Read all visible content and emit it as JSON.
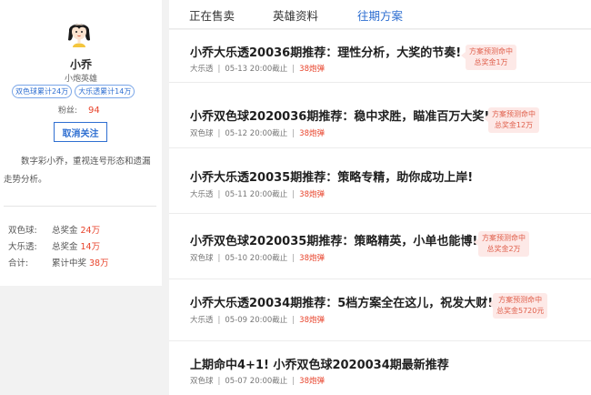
{
  "profile": {
    "name": "小乔",
    "subtitle": "小炮英雄",
    "tags": [
      "双色球累计24万",
      "大乐透累计14万"
    ],
    "fans_label": "粉丝:",
    "fans_value": "94",
    "unfollow_label": "取消关注",
    "bio": "数字彩小乔，重视连号形态和遗漏走势分析。",
    "stats": [
      {
        "key": "双色球:",
        "label": "总奖金",
        "value": "24万"
      },
      {
        "key": "大乐透:",
        "label": "总奖金",
        "value": "14万"
      },
      {
        "key": "合计:",
        "label": "累计中奖",
        "value": "38万"
      }
    ]
  },
  "tabs": [
    "正在售卖",
    "英雄资料",
    "往期方案"
  ],
  "active_tab": "往期方案",
  "items": [
    {
      "title": "小乔大乐透20036期推荐：理性分析，大奖的节奏!",
      "lottery": "大乐透",
      "deadline": "05-13 20:00截止",
      "price": "38炮弹",
      "badge_line1": "方案预测命中",
      "badge_line2": "总奖金1万"
    },
    {
      "title": "小乔双色球2020036期推荐：稳中求胜，瞄准百万大奖!",
      "lottery": "双色球",
      "deadline": "05-12 20:00截止",
      "price": "38炮弹",
      "badge_line1": "方案预测命中",
      "badge_line2": "总奖金12万"
    },
    {
      "title": "小乔大乐透20035期推荐：策略专精，助你成功上岸!",
      "lottery": "大乐透",
      "deadline": "05-11 20:00截止",
      "price": "38炮弹",
      "badge_line1": "",
      "badge_line2": ""
    },
    {
      "title": "小乔双色球2020035期推荐：策略精英，小单也能博!",
      "lottery": "双色球",
      "deadline": "05-10 20:00截止",
      "price": "38炮弹",
      "badge_line1": "方案预测命中",
      "badge_line2": "总奖金2万"
    },
    {
      "title": "小乔大乐透20034期推荐：5档方案全在这儿，祝发大财!",
      "lottery": "大乐透",
      "deadline": "05-09 20:00截止",
      "price": "38炮弹",
      "badge_line1": "方案预测命中",
      "badge_line2": "总奖金5720元"
    },
    {
      "title": "上期命中4+1! 小乔双色球2020034期最新推荐",
      "lottery": "双色球",
      "deadline": "05-07 20:00截止",
      "price": "38炮弹",
      "badge_line1": "",
      "badge_line2": ""
    }
  ],
  "colors": {
    "accent": "#2f6fd1",
    "highlight": "#e8442c",
    "badge_bg": "#fde9e7"
  },
  "icons": {
    "avatar": "cartoon-girl-avatar"
  }
}
